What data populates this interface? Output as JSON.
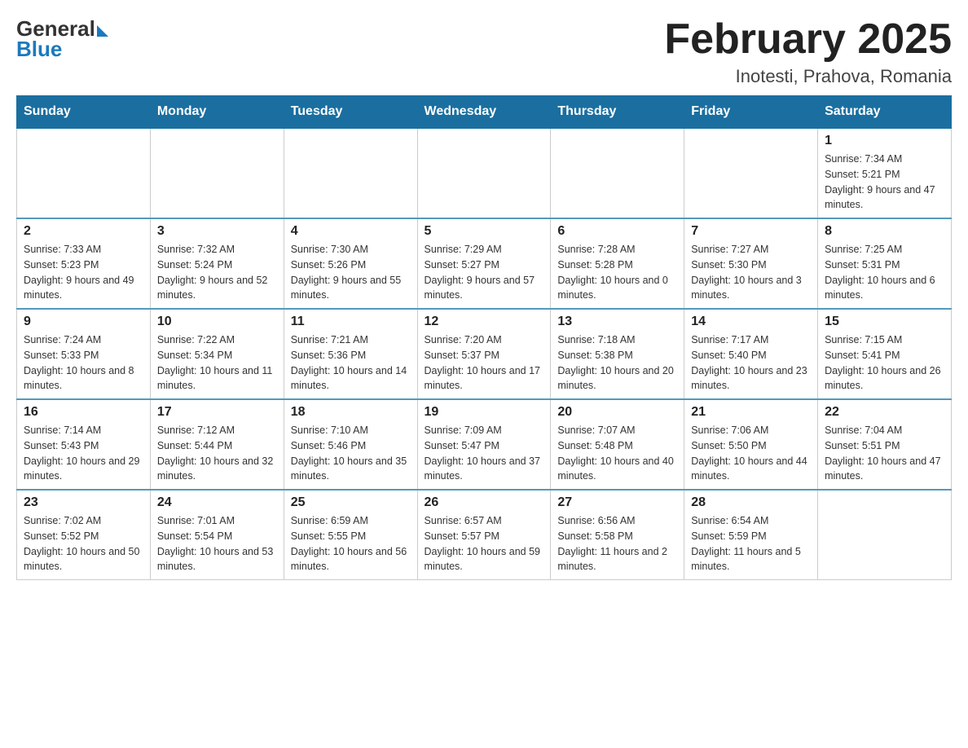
{
  "logo": {
    "general": "General",
    "blue": "Blue"
  },
  "header": {
    "month": "February 2025",
    "location": "Inotesti, Prahova, Romania"
  },
  "weekdays": [
    "Sunday",
    "Monday",
    "Tuesday",
    "Wednesday",
    "Thursday",
    "Friday",
    "Saturday"
  ],
  "weeks": [
    [
      {
        "day": "",
        "info": ""
      },
      {
        "day": "",
        "info": ""
      },
      {
        "day": "",
        "info": ""
      },
      {
        "day": "",
        "info": ""
      },
      {
        "day": "",
        "info": ""
      },
      {
        "day": "",
        "info": ""
      },
      {
        "day": "1",
        "info": "Sunrise: 7:34 AM\nSunset: 5:21 PM\nDaylight: 9 hours and 47 minutes."
      }
    ],
    [
      {
        "day": "2",
        "info": "Sunrise: 7:33 AM\nSunset: 5:23 PM\nDaylight: 9 hours and 49 minutes."
      },
      {
        "day": "3",
        "info": "Sunrise: 7:32 AM\nSunset: 5:24 PM\nDaylight: 9 hours and 52 minutes."
      },
      {
        "day": "4",
        "info": "Sunrise: 7:30 AM\nSunset: 5:26 PM\nDaylight: 9 hours and 55 minutes."
      },
      {
        "day": "5",
        "info": "Sunrise: 7:29 AM\nSunset: 5:27 PM\nDaylight: 9 hours and 57 minutes."
      },
      {
        "day": "6",
        "info": "Sunrise: 7:28 AM\nSunset: 5:28 PM\nDaylight: 10 hours and 0 minutes."
      },
      {
        "day": "7",
        "info": "Sunrise: 7:27 AM\nSunset: 5:30 PM\nDaylight: 10 hours and 3 minutes."
      },
      {
        "day": "8",
        "info": "Sunrise: 7:25 AM\nSunset: 5:31 PM\nDaylight: 10 hours and 6 minutes."
      }
    ],
    [
      {
        "day": "9",
        "info": "Sunrise: 7:24 AM\nSunset: 5:33 PM\nDaylight: 10 hours and 8 minutes."
      },
      {
        "day": "10",
        "info": "Sunrise: 7:22 AM\nSunset: 5:34 PM\nDaylight: 10 hours and 11 minutes."
      },
      {
        "day": "11",
        "info": "Sunrise: 7:21 AM\nSunset: 5:36 PM\nDaylight: 10 hours and 14 minutes."
      },
      {
        "day": "12",
        "info": "Sunrise: 7:20 AM\nSunset: 5:37 PM\nDaylight: 10 hours and 17 minutes."
      },
      {
        "day": "13",
        "info": "Sunrise: 7:18 AM\nSunset: 5:38 PM\nDaylight: 10 hours and 20 minutes."
      },
      {
        "day": "14",
        "info": "Sunrise: 7:17 AM\nSunset: 5:40 PM\nDaylight: 10 hours and 23 minutes."
      },
      {
        "day": "15",
        "info": "Sunrise: 7:15 AM\nSunset: 5:41 PM\nDaylight: 10 hours and 26 minutes."
      }
    ],
    [
      {
        "day": "16",
        "info": "Sunrise: 7:14 AM\nSunset: 5:43 PM\nDaylight: 10 hours and 29 minutes."
      },
      {
        "day": "17",
        "info": "Sunrise: 7:12 AM\nSunset: 5:44 PM\nDaylight: 10 hours and 32 minutes."
      },
      {
        "day": "18",
        "info": "Sunrise: 7:10 AM\nSunset: 5:46 PM\nDaylight: 10 hours and 35 minutes."
      },
      {
        "day": "19",
        "info": "Sunrise: 7:09 AM\nSunset: 5:47 PM\nDaylight: 10 hours and 37 minutes."
      },
      {
        "day": "20",
        "info": "Sunrise: 7:07 AM\nSunset: 5:48 PM\nDaylight: 10 hours and 40 minutes."
      },
      {
        "day": "21",
        "info": "Sunrise: 7:06 AM\nSunset: 5:50 PM\nDaylight: 10 hours and 44 minutes."
      },
      {
        "day": "22",
        "info": "Sunrise: 7:04 AM\nSunset: 5:51 PM\nDaylight: 10 hours and 47 minutes."
      }
    ],
    [
      {
        "day": "23",
        "info": "Sunrise: 7:02 AM\nSunset: 5:52 PM\nDaylight: 10 hours and 50 minutes."
      },
      {
        "day": "24",
        "info": "Sunrise: 7:01 AM\nSunset: 5:54 PM\nDaylight: 10 hours and 53 minutes."
      },
      {
        "day": "25",
        "info": "Sunrise: 6:59 AM\nSunset: 5:55 PM\nDaylight: 10 hours and 56 minutes."
      },
      {
        "day": "26",
        "info": "Sunrise: 6:57 AM\nSunset: 5:57 PM\nDaylight: 10 hours and 59 minutes."
      },
      {
        "day": "27",
        "info": "Sunrise: 6:56 AM\nSunset: 5:58 PM\nDaylight: 11 hours and 2 minutes."
      },
      {
        "day": "28",
        "info": "Sunrise: 6:54 AM\nSunset: 5:59 PM\nDaylight: 11 hours and 5 minutes."
      },
      {
        "day": "",
        "info": ""
      }
    ]
  ]
}
